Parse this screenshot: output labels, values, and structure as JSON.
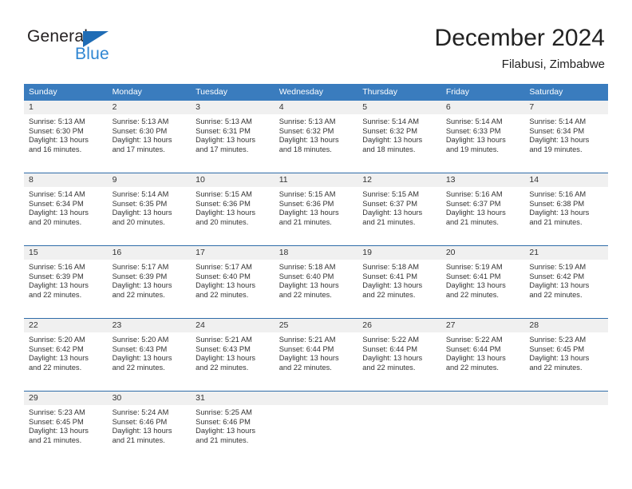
{
  "logo": {
    "word_top": "General",
    "word_bottom": "Blue",
    "triangle_color": "#1f6cb5",
    "blue_text_color": "#2f86d2"
  },
  "header": {
    "title": "December 2024",
    "subtitle": "Filabusi, Zimbabwe"
  },
  "theme": {
    "header_row_bg": "#3a7cbe",
    "row_divider": "#2f6ca8",
    "daynum_band_bg": "#f0f0f0",
    "text": "#333333"
  },
  "weekday_headers": [
    "Sunday",
    "Monday",
    "Tuesday",
    "Wednesday",
    "Thursday",
    "Friday",
    "Saturday"
  ],
  "weeks": [
    [
      {
        "day": "1",
        "sunrise": "Sunrise: 5:13 AM",
        "sunset": "Sunset: 6:30 PM",
        "daylight_1": "Daylight: 13 hours",
        "daylight_2": "and 16 minutes."
      },
      {
        "day": "2",
        "sunrise": "Sunrise: 5:13 AM",
        "sunset": "Sunset: 6:30 PM",
        "daylight_1": "Daylight: 13 hours",
        "daylight_2": "and 17 minutes."
      },
      {
        "day": "3",
        "sunrise": "Sunrise: 5:13 AM",
        "sunset": "Sunset: 6:31 PM",
        "daylight_1": "Daylight: 13 hours",
        "daylight_2": "and 17 minutes."
      },
      {
        "day": "4",
        "sunrise": "Sunrise: 5:13 AM",
        "sunset": "Sunset: 6:32 PM",
        "daylight_1": "Daylight: 13 hours",
        "daylight_2": "and 18 minutes."
      },
      {
        "day": "5",
        "sunrise": "Sunrise: 5:14 AM",
        "sunset": "Sunset: 6:32 PM",
        "daylight_1": "Daylight: 13 hours",
        "daylight_2": "and 18 minutes."
      },
      {
        "day": "6",
        "sunrise": "Sunrise: 5:14 AM",
        "sunset": "Sunset: 6:33 PM",
        "daylight_1": "Daylight: 13 hours",
        "daylight_2": "and 19 minutes."
      },
      {
        "day": "7",
        "sunrise": "Sunrise: 5:14 AM",
        "sunset": "Sunset: 6:34 PM",
        "daylight_1": "Daylight: 13 hours",
        "daylight_2": "and 19 minutes."
      }
    ],
    [
      {
        "day": "8",
        "sunrise": "Sunrise: 5:14 AM",
        "sunset": "Sunset: 6:34 PM",
        "daylight_1": "Daylight: 13 hours",
        "daylight_2": "and 20 minutes."
      },
      {
        "day": "9",
        "sunrise": "Sunrise: 5:14 AM",
        "sunset": "Sunset: 6:35 PM",
        "daylight_1": "Daylight: 13 hours",
        "daylight_2": "and 20 minutes."
      },
      {
        "day": "10",
        "sunrise": "Sunrise: 5:15 AM",
        "sunset": "Sunset: 6:36 PM",
        "daylight_1": "Daylight: 13 hours",
        "daylight_2": "and 20 minutes."
      },
      {
        "day": "11",
        "sunrise": "Sunrise: 5:15 AM",
        "sunset": "Sunset: 6:36 PM",
        "daylight_1": "Daylight: 13 hours",
        "daylight_2": "and 21 minutes."
      },
      {
        "day": "12",
        "sunrise": "Sunrise: 5:15 AM",
        "sunset": "Sunset: 6:37 PM",
        "daylight_1": "Daylight: 13 hours",
        "daylight_2": "and 21 minutes."
      },
      {
        "day": "13",
        "sunrise": "Sunrise: 5:16 AM",
        "sunset": "Sunset: 6:37 PM",
        "daylight_1": "Daylight: 13 hours",
        "daylight_2": "and 21 minutes."
      },
      {
        "day": "14",
        "sunrise": "Sunrise: 5:16 AM",
        "sunset": "Sunset: 6:38 PM",
        "daylight_1": "Daylight: 13 hours",
        "daylight_2": "and 21 minutes."
      }
    ],
    [
      {
        "day": "15",
        "sunrise": "Sunrise: 5:16 AM",
        "sunset": "Sunset: 6:39 PM",
        "daylight_1": "Daylight: 13 hours",
        "daylight_2": "and 22 minutes."
      },
      {
        "day": "16",
        "sunrise": "Sunrise: 5:17 AM",
        "sunset": "Sunset: 6:39 PM",
        "daylight_1": "Daylight: 13 hours",
        "daylight_2": "and 22 minutes."
      },
      {
        "day": "17",
        "sunrise": "Sunrise: 5:17 AM",
        "sunset": "Sunset: 6:40 PM",
        "daylight_1": "Daylight: 13 hours",
        "daylight_2": "and 22 minutes."
      },
      {
        "day": "18",
        "sunrise": "Sunrise: 5:18 AM",
        "sunset": "Sunset: 6:40 PM",
        "daylight_1": "Daylight: 13 hours",
        "daylight_2": "and 22 minutes."
      },
      {
        "day": "19",
        "sunrise": "Sunrise: 5:18 AM",
        "sunset": "Sunset: 6:41 PM",
        "daylight_1": "Daylight: 13 hours",
        "daylight_2": "and 22 minutes."
      },
      {
        "day": "20",
        "sunrise": "Sunrise: 5:19 AM",
        "sunset": "Sunset: 6:41 PM",
        "daylight_1": "Daylight: 13 hours",
        "daylight_2": "and 22 minutes."
      },
      {
        "day": "21",
        "sunrise": "Sunrise: 5:19 AM",
        "sunset": "Sunset: 6:42 PM",
        "daylight_1": "Daylight: 13 hours",
        "daylight_2": "and 22 minutes."
      }
    ],
    [
      {
        "day": "22",
        "sunrise": "Sunrise: 5:20 AM",
        "sunset": "Sunset: 6:42 PM",
        "daylight_1": "Daylight: 13 hours",
        "daylight_2": "and 22 minutes."
      },
      {
        "day": "23",
        "sunrise": "Sunrise: 5:20 AM",
        "sunset": "Sunset: 6:43 PM",
        "daylight_1": "Daylight: 13 hours",
        "daylight_2": "and 22 minutes."
      },
      {
        "day": "24",
        "sunrise": "Sunrise: 5:21 AM",
        "sunset": "Sunset: 6:43 PM",
        "daylight_1": "Daylight: 13 hours",
        "daylight_2": "and 22 minutes."
      },
      {
        "day": "25",
        "sunrise": "Sunrise: 5:21 AM",
        "sunset": "Sunset: 6:44 PM",
        "daylight_1": "Daylight: 13 hours",
        "daylight_2": "and 22 minutes."
      },
      {
        "day": "26",
        "sunrise": "Sunrise: 5:22 AM",
        "sunset": "Sunset: 6:44 PM",
        "daylight_1": "Daylight: 13 hours",
        "daylight_2": "and 22 minutes."
      },
      {
        "day": "27",
        "sunrise": "Sunrise: 5:22 AM",
        "sunset": "Sunset: 6:44 PM",
        "daylight_1": "Daylight: 13 hours",
        "daylight_2": "and 22 minutes."
      },
      {
        "day": "28",
        "sunrise": "Sunrise: 5:23 AM",
        "sunset": "Sunset: 6:45 PM",
        "daylight_1": "Daylight: 13 hours",
        "daylight_2": "and 22 minutes."
      }
    ],
    [
      {
        "day": "29",
        "sunrise": "Sunrise: 5:23 AM",
        "sunset": "Sunset: 6:45 PM",
        "daylight_1": "Daylight: 13 hours",
        "daylight_2": "and 21 minutes."
      },
      {
        "day": "30",
        "sunrise": "Sunrise: 5:24 AM",
        "sunset": "Sunset: 6:46 PM",
        "daylight_1": "Daylight: 13 hours",
        "daylight_2": "and 21 minutes."
      },
      {
        "day": "31",
        "sunrise": "Sunrise: 5:25 AM",
        "sunset": "Sunset: 6:46 PM",
        "daylight_1": "Daylight: 13 hours",
        "daylight_2": "and 21 minutes."
      },
      {
        "day": "",
        "sunrise": "",
        "sunset": "",
        "daylight_1": "",
        "daylight_2": ""
      },
      {
        "day": "",
        "sunrise": "",
        "sunset": "",
        "daylight_1": "",
        "daylight_2": ""
      },
      {
        "day": "",
        "sunrise": "",
        "sunset": "",
        "daylight_1": "",
        "daylight_2": ""
      },
      {
        "day": "",
        "sunrise": "",
        "sunset": "",
        "daylight_1": "",
        "daylight_2": ""
      }
    ]
  ]
}
